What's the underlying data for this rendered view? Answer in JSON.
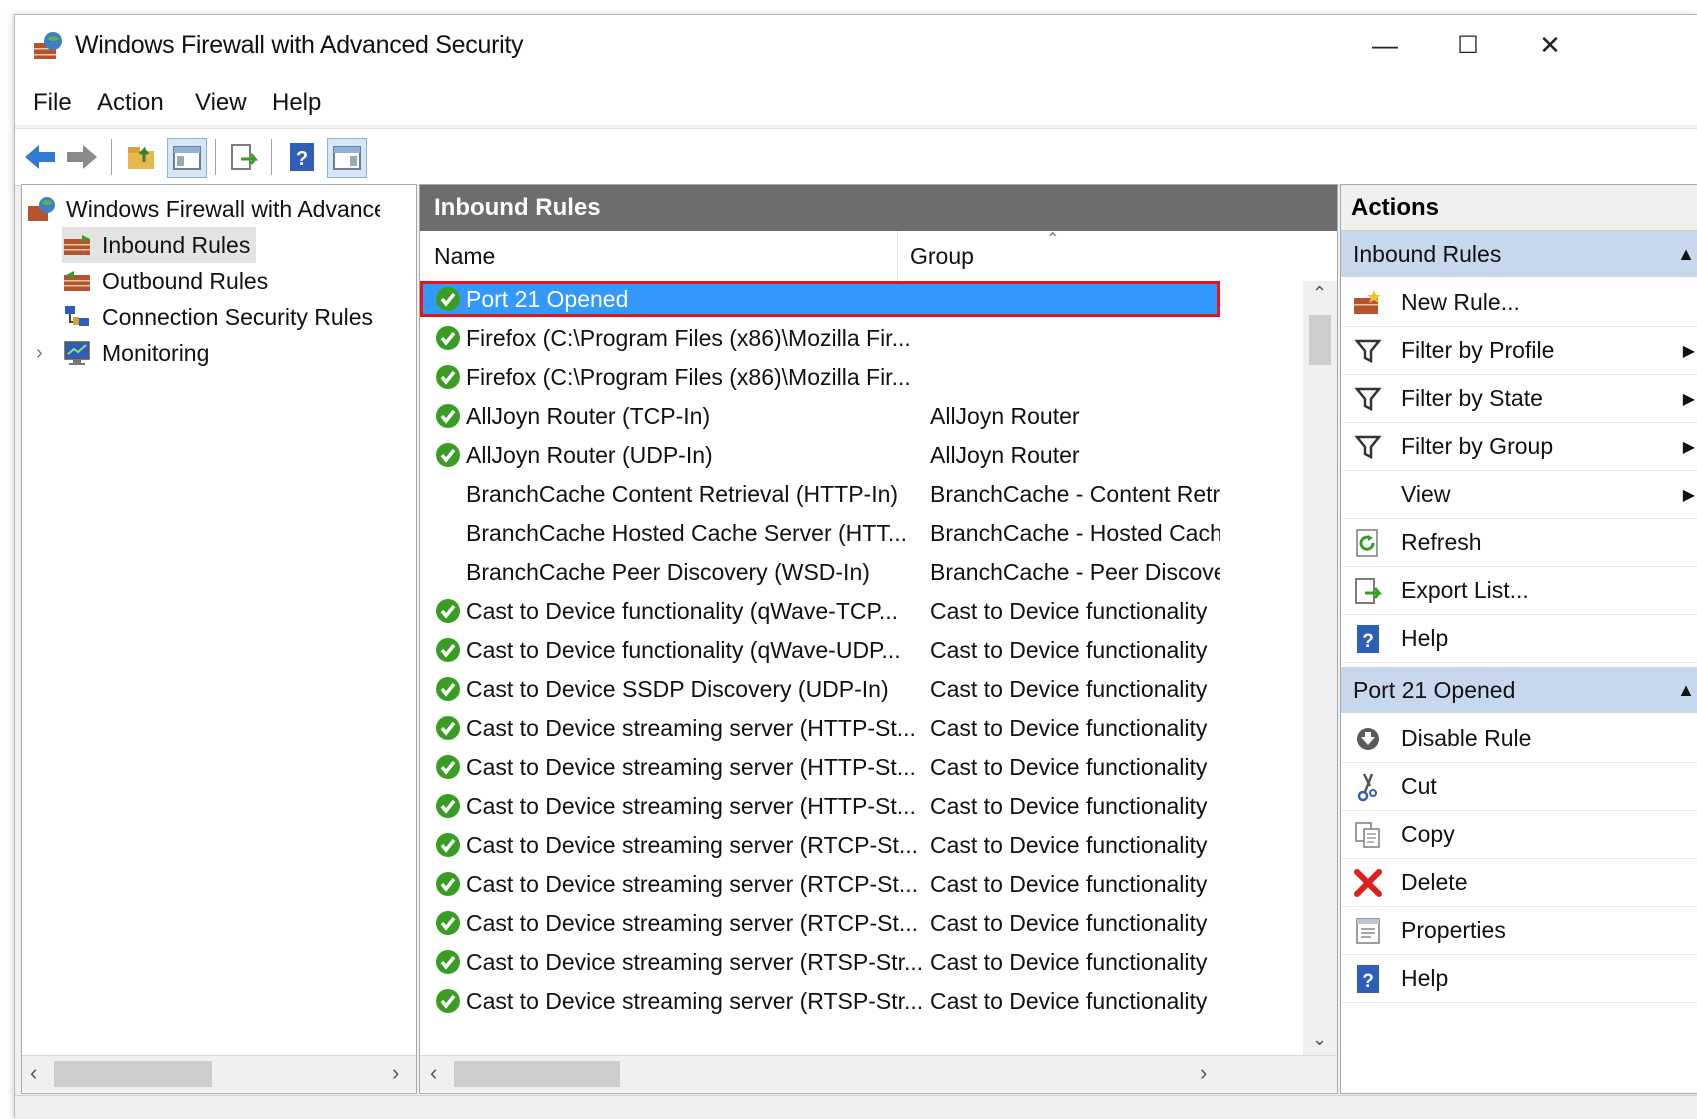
{
  "window": {
    "title": "Windows Firewall with Advanced Security",
    "controls": {
      "minimize": "—",
      "maximize": "☐",
      "close": "✕"
    }
  },
  "menu": [
    "File",
    "Action",
    "View",
    "Help"
  ],
  "toolbar_icons": [
    "back-arrow-icon",
    "forward-arrow-icon",
    "up-folder-icon",
    "show-hide-tree-icon",
    "export-icon",
    "help-icon",
    "show-hide-action-pane-icon"
  ],
  "tree": {
    "root": "Windows Firewall with Advanced Security",
    "items": [
      "Inbound Rules",
      "Outbound Rules",
      "Connection Security Rules",
      "Monitoring"
    ]
  },
  "center": {
    "header": "Inbound Rules",
    "columns": {
      "name": "Name",
      "group": "Group"
    },
    "rows": [
      {
        "name": "Port 21 Opened",
        "group": "",
        "enabled": true,
        "selected": true
      },
      {
        "name": "Firefox (C:\\Program Files (x86)\\Mozilla Fir...",
        "group": "",
        "enabled": true
      },
      {
        "name": "Firefox (C:\\Program Files (x86)\\Mozilla Fir...",
        "group": "",
        "enabled": true
      },
      {
        "name": "AllJoyn Router (TCP-In)",
        "group": "AllJoyn Router",
        "enabled": true
      },
      {
        "name": "AllJoyn Router (UDP-In)",
        "group": "AllJoyn Router",
        "enabled": true
      },
      {
        "name": "BranchCache Content Retrieval (HTTP-In)",
        "group": "BranchCache - Content Retr...",
        "enabled": false
      },
      {
        "name": "BranchCache Hosted Cache Server (HTT...",
        "group": "BranchCache - Hosted Cach...",
        "enabled": false
      },
      {
        "name": "BranchCache Peer Discovery (WSD-In)",
        "group": "BranchCache - Peer Discove...",
        "enabled": false
      },
      {
        "name": "Cast to Device functionality (qWave-TCP...",
        "group": "Cast to Device functionality",
        "enabled": true
      },
      {
        "name": "Cast to Device functionality (qWave-UDP...",
        "group": "Cast to Device functionality",
        "enabled": true
      },
      {
        "name": "Cast to Device SSDP Discovery (UDP-In)",
        "group": "Cast to Device functionality",
        "enabled": true
      },
      {
        "name": "Cast to Device streaming server (HTTP-St...",
        "group": "Cast to Device functionality",
        "enabled": true
      },
      {
        "name": "Cast to Device streaming server (HTTP-St...",
        "group": "Cast to Device functionality",
        "enabled": true
      },
      {
        "name": "Cast to Device streaming server (HTTP-St...",
        "group": "Cast to Device functionality",
        "enabled": true
      },
      {
        "name": "Cast to Device streaming server (RTCP-St...",
        "group": "Cast to Device functionality",
        "enabled": true
      },
      {
        "name": "Cast to Device streaming server (RTCP-St...",
        "group": "Cast to Device functionality",
        "enabled": true
      },
      {
        "name": "Cast to Device streaming server (RTCP-St...",
        "group": "Cast to Device functionality",
        "enabled": true
      },
      {
        "name": "Cast to Device streaming server (RTSP-Str...",
        "group": "Cast to Device functionality",
        "enabled": true
      },
      {
        "name": "Cast to Device streaming server (RTSP-Str...",
        "group": "Cast to Device functionality",
        "enabled": true
      }
    ]
  },
  "actions": {
    "header": "Actions",
    "groups": [
      {
        "title": "Inbound Rules",
        "items": [
          {
            "label": "New Rule...",
            "icon": "new-rule-icon",
            "submenu": false
          },
          {
            "label": "Filter by Profile",
            "icon": "filter-icon",
            "submenu": true
          },
          {
            "label": "Filter by State",
            "icon": "filter-icon",
            "submenu": true
          },
          {
            "label": "Filter by Group",
            "icon": "filter-icon",
            "submenu": true
          },
          {
            "label": "View",
            "icon": "",
            "submenu": true
          },
          {
            "label": "Refresh",
            "icon": "refresh-icon",
            "submenu": false
          },
          {
            "label": "Export List...",
            "icon": "export-icon",
            "submenu": false
          },
          {
            "label": "Help",
            "icon": "help-icon",
            "submenu": false
          }
        ]
      },
      {
        "title": "Port 21 Opened",
        "items": [
          {
            "label": "Disable Rule",
            "icon": "disable-rule-icon",
            "submenu": false
          },
          {
            "label": "Cut",
            "icon": "scissors-icon",
            "submenu": false
          },
          {
            "label": "Copy",
            "icon": "copy-icon",
            "submenu": false
          },
          {
            "label": "Delete",
            "icon": "delete-icon",
            "submenu": false
          },
          {
            "label": "Properties",
            "icon": "properties-icon",
            "submenu": false
          },
          {
            "label": "Help",
            "icon": "help-icon",
            "submenu": false
          }
        ]
      }
    ]
  },
  "colors": {
    "selection": "#3399ff",
    "selection_outline": "#e8141a",
    "action_group": "#c7d8ec",
    "pane_header": "#6d6d6d",
    "check_green": "#3a9d23"
  }
}
